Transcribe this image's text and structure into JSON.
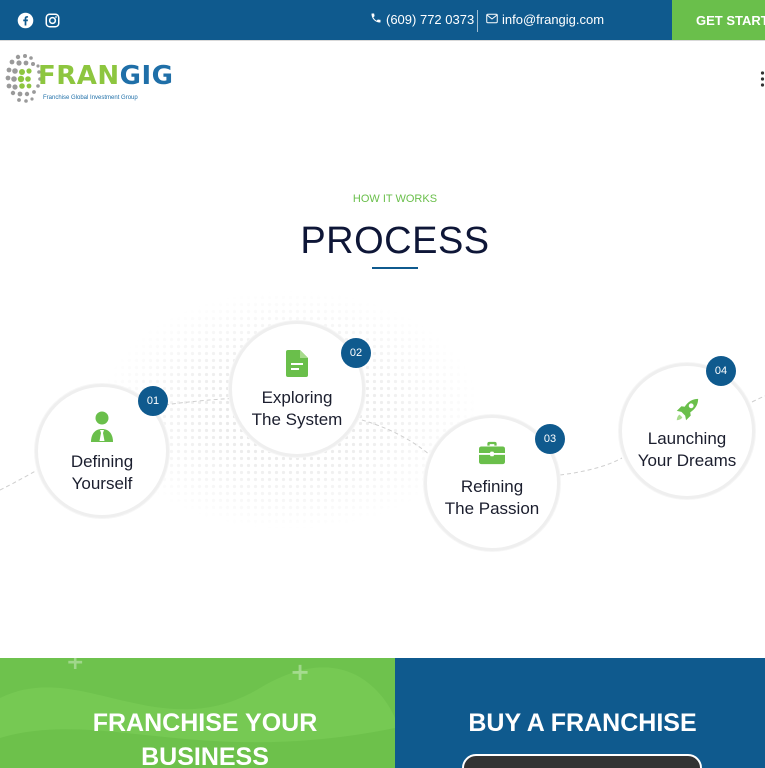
{
  "topbar": {
    "phone": "(609) 772 0373",
    "email": "info@frangig.com",
    "cta_label": "GET STARTED",
    "social": [
      {
        "icon": "facebook-icon"
      },
      {
        "icon": "instagram-icon"
      }
    ]
  },
  "logo": {
    "word_part1": "FRAN",
    "word_part2": "GIG",
    "tagline": "Franchise Global Investment Group"
  },
  "process": {
    "eyebrow": "HOW IT WORKS",
    "title": "PROCESS",
    "steps": [
      {
        "number": "01",
        "line1": "Defining",
        "line2": "Yourself",
        "icon": "person-icon"
      },
      {
        "number": "02",
        "line1": "Exploring",
        "line2": "The System",
        "icon": "document-icon"
      },
      {
        "number": "03",
        "line1": "Refining",
        "line2": "The Passion",
        "icon": "briefcase-icon"
      },
      {
        "number": "04",
        "line1": "Launching",
        "line2": "Your Dreams",
        "icon": "rocket-icon"
      }
    ]
  },
  "panels": {
    "left_title_line1": "FRANCHISE YOUR",
    "left_title_line2": "BUSINESS",
    "right_title": "BUY A FRANCHISE"
  },
  "colors": {
    "brand_blue": "#0f5a8e",
    "brand_green": "#6abf4b",
    "heading_dark": "#0e1637"
  }
}
